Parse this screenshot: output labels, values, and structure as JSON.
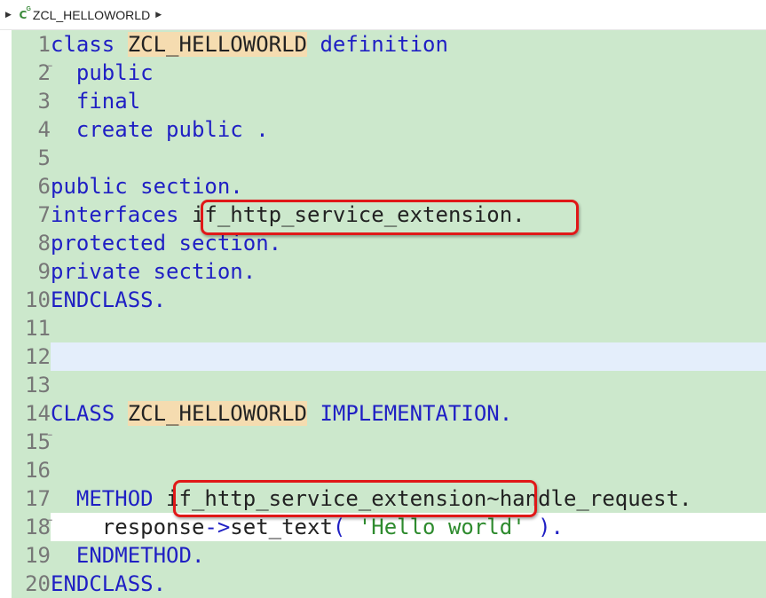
{
  "breadcrumb": {
    "title": "ZCL_HELLOWORLD",
    "class_icon": "C",
    "class_icon_sup": "G"
  },
  "lines": [
    {
      "n": "1",
      "fold": true,
      "tokens": [
        {
          "t": "class ",
          "c": "kw"
        },
        {
          "t": "ZCL_HELLOWORLD",
          "c": "cls"
        },
        {
          "t": " definition",
          "c": "kw"
        }
      ]
    },
    {
      "n": "2",
      "fold": false,
      "tokens": [
        {
          "t": "  public",
          "c": "kw"
        }
      ]
    },
    {
      "n": "3",
      "fold": false,
      "tokens": [
        {
          "t": "  final",
          "c": "kw"
        }
      ]
    },
    {
      "n": "4",
      "fold": false,
      "tokens": [
        {
          "t": "  create public .",
          "c": "kw"
        }
      ]
    },
    {
      "n": "5",
      "fold": false,
      "tokens": []
    },
    {
      "n": "6",
      "fold": false,
      "tokens": [
        {
          "t": "public section.",
          "c": "kw"
        }
      ]
    },
    {
      "n": "7",
      "fold": false,
      "tokens": [
        {
          "t": "interfaces ",
          "c": "kw"
        },
        {
          "t": "if_http_service_extension.",
          "c": "plain"
        }
      ]
    },
    {
      "n": "8",
      "fold": false,
      "tokens": [
        {
          "t": "protected section.",
          "c": "kw"
        }
      ]
    },
    {
      "n": "9",
      "fold": false,
      "tokens": [
        {
          "t": "private section.",
          "c": "kw"
        }
      ]
    },
    {
      "n": "10",
      "fold": false,
      "tokens": [
        {
          "t": "ENDCLASS.",
          "c": "kw"
        }
      ]
    },
    {
      "n": "11",
      "fold": false,
      "tokens": []
    },
    {
      "n": "12",
      "fold": false,
      "tokens": []
    },
    {
      "n": "13",
      "fold": false,
      "tokens": []
    },
    {
      "n": "14",
      "fold": true,
      "tokens": [
        {
          "t": "CLASS ",
          "c": "kw"
        },
        {
          "t": "ZCL_HELLOWORLD",
          "c": "cls"
        },
        {
          "t": " IMPLEMENTATION.",
          "c": "kw"
        }
      ]
    },
    {
      "n": "15",
      "fold": false,
      "tokens": []
    },
    {
      "n": "16",
      "fold": false,
      "tokens": []
    },
    {
      "n": "17",
      "fold": true,
      "tokens": [
        {
          "t": "  METHOD ",
          "c": "kw"
        },
        {
          "t": "if_http_service_extension~handle_request.",
          "c": "plain"
        }
      ]
    },
    {
      "n": "18",
      "fold": false,
      "tokens": [
        {
          "t": "    response",
          "c": "plain"
        },
        {
          "t": "->",
          "c": "kw"
        },
        {
          "t": "set_text",
          "c": "plain"
        },
        {
          "t": "( ",
          "c": "kw"
        },
        {
          "t": "'Hello world'",
          "c": "str"
        },
        {
          "t": " ).",
          "c": "kw"
        }
      ]
    },
    {
      "n": "19",
      "fold": false,
      "tokens": [
        {
          "t": "  ENDMETHOD.",
          "c": "kw"
        }
      ]
    },
    {
      "n": "20",
      "fold": false,
      "tokens": [
        {
          "t": "ENDCLASS.",
          "c": "kw"
        }
      ]
    }
  ],
  "colors": {
    "editor_bg": "#cce8cc",
    "keyword": "#1f1fc4",
    "class_name_bg": "#f5dcb0",
    "string": "#2e8b2e",
    "annotation_box": "#e01818"
  }
}
